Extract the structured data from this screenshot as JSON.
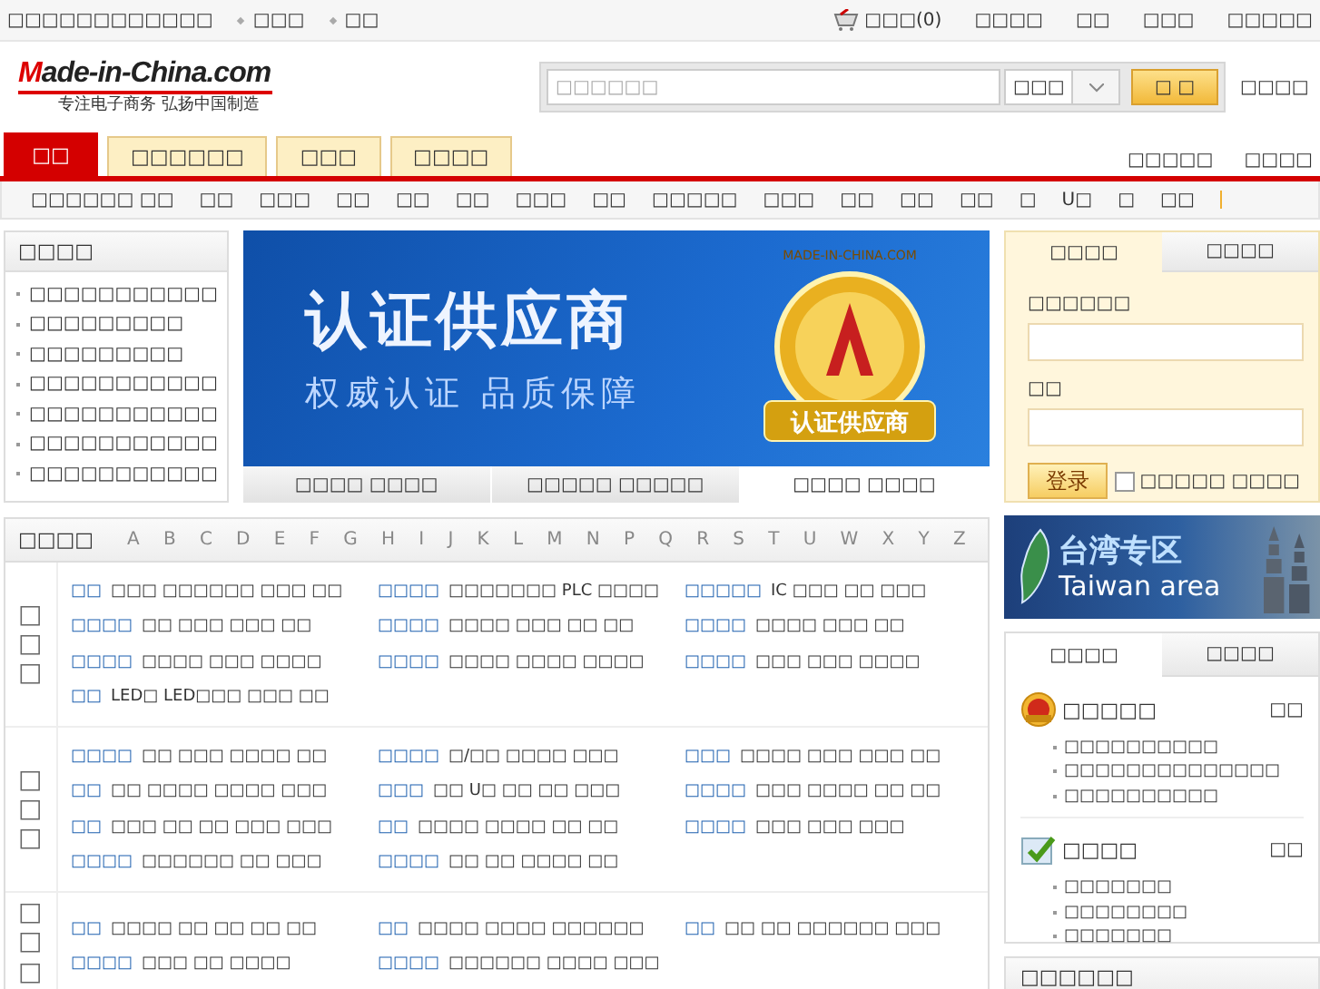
{
  "top_bar": {
    "left_links": [
      "□□□□□□□□□□□□",
      "□□□",
      "□□"
    ],
    "cart": "□□□(0)",
    "right_links": [
      "□□□□",
      "□□",
      "□□□",
      "□□□□□"
    ]
  },
  "header": {
    "logo": "Made-in-China.com",
    "slogan": "专注电子商务 弘扬中国制造",
    "search": {
      "placeholder": "□□□□□□",
      "scope": "□□□",
      "button": "□ □"
    },
    "side_link": "□□□□"
  },
  "main_tabs": [
    {
      "label": "□□",
      "selected": true
    },
    {
      "label": "□□□□□□",
      "selected": false
    },
    {
      "label": "□□□",
      "selected": false
    },
    {
      "label": "□□□□",
      "selected": false
    }
  ],
  "header_links": [
    "□□□□□",
    "□□□□"
  ],
  "category_nav": [
    "□□□□□□ □□",
    "□□",
    "□□□",
    "□□",
    "□□",
    "□□",
    "□□□",
    "□□",
    "□□□□□",
    "□□□",
    "□□",
    "□□",
    "□□",
    "□",
    "U□",
    "□",
    "□□"
  ],
  "side_panel": {
    "title": "□□□□",
    "items": [
      "□□□□□□□□□□□",
      "□□□□□□□□□",
      "□□□□□□□□□",
      "□□□□□□□□□□□",
      "□□□□□□□□□□□",
      "□□□□□□□□□□□",
      "□□□□□□□□□□□"
    ]
  },
  "banner": {
    "headline": "认证供应商",
    "tagline": "权威认证 品质保障",
    "seal_text": "MADE-IN-CHINA.COM",
    "seal_label": "认证供应商",
    "tabs": [
      {
        "label": "□□□□ □□□□",
        "selected": false
      },
      {
        "label": "□□□□□ □□□□□",
        "selected": false
      },
      {
        "label": "□□□□ □□□□",
        "selected": true
      }
    ]
  },
  "login": {
    "tabs": [
      {
        "label": "□□□□",
        "selected": true
      },
      {
        "label": "□□□□",
        "selected": false
      }
    ],
    "username_label": "□□□□□□",
    "password_label": "□□",
    "button": "登录",
    "remember": {
      "label": "□□□□□ □□□□",
      "checked": false
    }
  },
  "categories": {
    "title": "□□□□",
    "letters": [
      "A",
      "B",
      "C",
      "D",
      "E",
      "F",
      "G",
      "H",
      "I",
      "J",
      "K",
      "L",
      "M",
      "N",
      "P",
      "Q",
      "R",
      "S",
      "T",
      "U",
      "W",
      "X",
      "Y",
      "Z"
    ],
    "groups": [
      {
        "label": "□□□",
        "columns": [
          [
            {
              "link": "□□",
              "text": "□□□ □□□□□□ □□□ □□"
            },
            {
              "link": "□□□□",
              "text": "□□ □□□ □□□ □□"
            },
            {
              "link": "□□□□",
              "text": "□□□□ □□□ □□□□"
            },
            {
              "link": "□□",
              "text": "LED□ LED□□□ □□□ □□"
            }
          ],
          [
            {
              "link": "□□□□",
              "text": "□□□□□□□ PLC □□□□"
            },
            {
              "link": "□□□□",
              "text": "□□□□ □□□ □□ □□"
            },
            {
              "link": "□□□□",
              "text": "□□□□ □□□□ □□□□"
            }
          ],
          [
            {
              "link": "□□□□□",
              "text": "IC □□□ □□ □□□"
            },
            {
              "link": "□□□□",
              "text": "□□□□ □□□ □□"
            },
            {
              "link": "□□□□",
              "text": "□□□ □□□ □□□□"
            }
          ]
        ]
      },
      {
        "label": "□□□",
        "columns": [
          [
            {
              "link": "□□□□",
              "text": "□□ □□□ □□□□ □□"
            },
            {
              "link": "□□",
              "text": "□□ □□□□ □□□□ □□□"
            },
            {
              "link": "□□",
              "text": "□□□ □□ □□ □□□ □□□"
            },
            {
              "link": "□□□□",
              "text": "□□□□□□ □□ □□□"
            }
          ],
          [
            {
              "link": "□□□□",
              "text": "□/□□ □□□□ □□□"
            },
            {
              "link": "□□□",
              "text": "□□ U□ □□ □□ □□□"
            },
            {
              "link": "□□",
              "text": "□□□□ □□□□ □□ □□"
            },
            {
              "link": "□□□□",
              "text": "□□ □□ □□□□ □□"
            }
          ],
          [
            {
              "link": "□□□",
              "text": "□□□□ □□□ □□□ □□"
            },
            {
              "link": "□□□□",
              "text": "□□□ □□□□ □□ □□"
            },
            {
              "link": "□□□□",
              "text": "□□□ □□□ □□□"
            }
          ]
        ]
      },
      {
        "label": "□□□",
        "columns": [
          [
            {
              "link": "□□",
              "text": "□□□□ □□ □□ □□ □□"
            },
            {
              "link": "□□□□",
              "text": "□□□ □□ □□□□"
            }
          ],
          [
            {
              "link": "□□",
              "text": "□□□□ □□□□ □□□□□□"
            },
            {
              "link": "□□□□",
              "text": "□□□□□□ □□□□ □□□"
            }
          ],
          [
            {
              "link": "□□",
              "text": "□□ □□ □□□□□□ □□□"
            }
          ]
        ]
      }
    ]
  },
  "taiwan_banner": {
    "title": "台湾专区",
    "subtitle": "Taiwan area"
  },
  "service_panel": {
    "tabs": [
      {
        "label": "□□□□",
        "selected": true
      },
      {
        "label": "□□□□",
        "selected": false
      }
    ],
    "sections": [
      {
        "kind": "medal",
        "title": "□□□□□",
        "more": "□□",
        "items": [
          "□□□□□□□□□□",
          "□□□□□□□□□□□□□□",
          "□□□□□□□□□□"
        ]
      },
      {
        "kind": "check",
        "title": "□□□□",
        "more": "□□",
        "items": [
          "□□□□□□□",
          "□□□□□□□□",
          "□□□□□□□"
        ]
      }
    ]
  },
  "bottom_panel": {
    "title": "□□□□□□"
  }
}
